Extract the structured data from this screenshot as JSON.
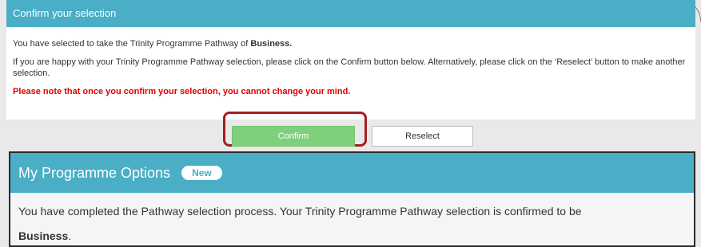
{
  "confirm_panel": {
    "title": "Confirm your selection",
    "selected_prefix": "You have selected to take the Trinity Programme Pathway of ",
    "selected_pathway": "Business.",
    "instructions": "If you are happy with your Trinity Programme Pathway selection, please click on the Confirm button below. Alternatively, please click on the ‘Reselect’ button to make another selection.",
    "warning": "Please note that once you confirm your selection, you cannot change your mind."
  },
  "buttons": {
    "confirm_label": "Confirm",
    "reselect_label": "Reselect"
  },
  "options_panel": {
    "title": "My Programme Options",
    "badge": "New",
    "message": "You have completed the Pathway selection process. Your Trinity Programme Pathway selection is confirmed to be",
    "pathway": "Business",
    "pathway_suffix": "."
  },
  "colors": {
    "header_blue": "#49aec6",
    "confirm_green": "#7fd07d",
    "warning_red": "#e00000",
    "highlight_border": "#a41e1e"
  }
}
